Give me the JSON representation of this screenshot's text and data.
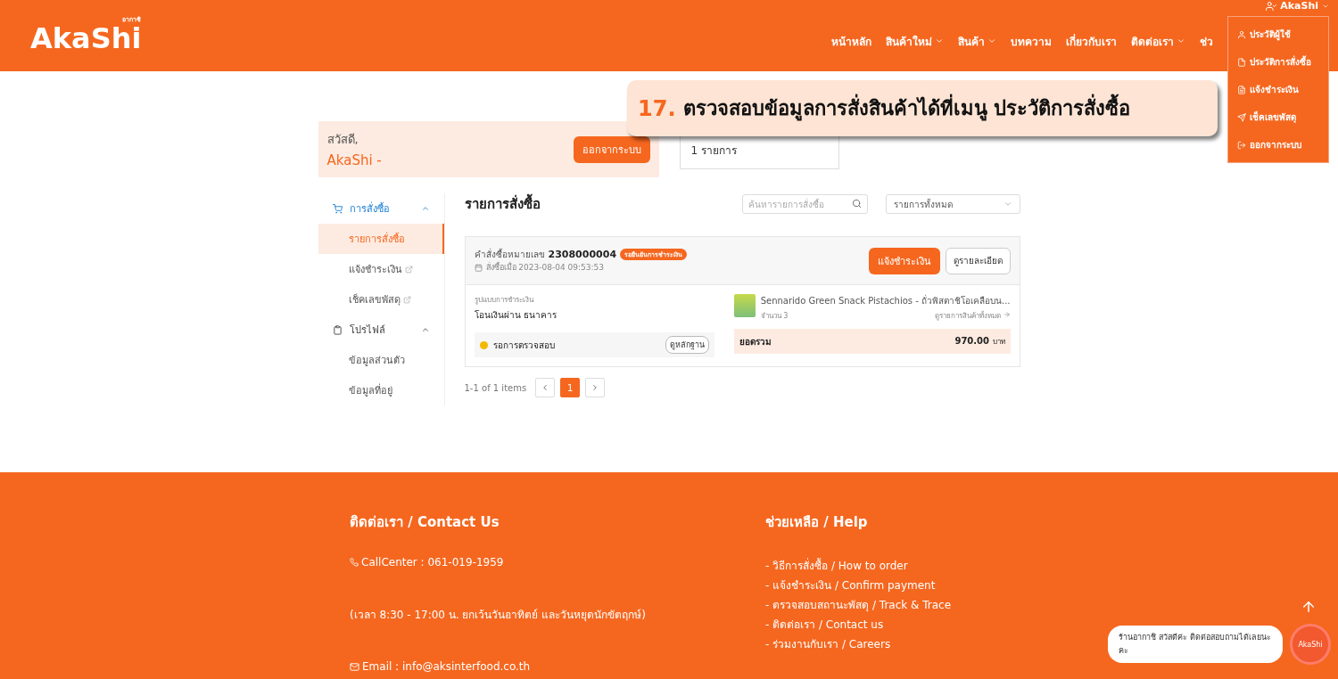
{
  "header": {
    "logo": "AkaShi",
    "logo_sub": "อากาชิ",
    "user": "AkaShi",
    "nav": [
      {
        "label": "หน้าหลัก",
        "dropdown": false
      },
      {
        "label": "สินค้าใหม่",
        "dropdown": true
      },
      {
        "label": "สินค้า",
        "dropdown": true
      },
      {
        "label": "บทความ",
        "dropdown": false
      },
      {
        "label": "เกี่ยวกับเรา",
        "dropdown": false
      },
      {
        "label": "ติดต่อเรา",
        "dropdown": true
      },
      {
        "label": "ช่ว",
        "dropdown": false
      }
    ],
    "user_menu": [
      {
        "label": "ประวัติผู้ใช้",
        "kind": "user"
      },
      {
        "label": "ประวัติการสั่งซื้อ",
        "kind": "file"
      },
      {
        "label": "แจ้งชำระเงิน",
        "kind": "doc"
      },
      {
        "label": "เช็คเลขพัสดุ",
        "kind": "send"
      },
      {
        "label": "ออกจากระบบ",
        "kind": "logout"
      }
    ]
  },
  "banner": {
    "number": "17.",
    "text": "ตรวจสอบข้อมูลการสั่งสินค้าได้ที่เมนู ประวัติการสั่งซื้อ"
  },
  "welcome": {
    "greeting": "สวัสดี,",
    "name": "AkaShi -",
    "button": "ออกจากระบบ"
  },
  "stats": {
    "value": "1 รายการ"
  },
  "sidebar": [
    {
      "label": "การสั่งซื้อ",
      "kind": "cart",
      "expanded": true,
      "children": [
        {
          "label": "รายการสั่งซื้อ",
          "selected": true,
          "external": false
        },
        {
          "label": "แจ้งชำระเงิน",
          "selected": false,
          "external": true
        },
        {
          "label": "เช็คเลขพัสดุ",
          "selected": false,
          "external": true
        }
      ]
    },
    {
      "label": "โปรไฟล์",
      "kind": "profile",
      "expanded": true,
      "children": [
        {
          "label": "ข้อมูลส่วนตัว",
          "selected": false,
          "external": false
        },
        {
          "label": "ข้อมูลที่อยู่",
          "selected": false,
          "external": false
        }
      ]
    }
  ],
  "orders": {
    "title": "รายการสั่งซื้อ",
    "search_placeholder": "ค้นหารายการสั่งซื้อ",
    "filter": "รายการทั้งหมด",
    "order": {
      "number_label": "คำสั่งซื้อหมายเลข",
      "number": "2308000004",
      "status": "รอยืนยันการชำระเงิน",
      "date": "สั่งซื้อเมื่อ 2023-08-04 09:53:53",
      "pay_button": "แจ้งชำระเงิน",
      "detail_button": "ดูรายละเอียด",
      "payment_label": "รูปแบบการชำระเงิน",
      "payment_method": "โอนเงินผ่าน ธนาคาร",
      "check_status": "รอการตรวจสอบ",
      "evidence_button": "ดูหลักฐาน",
      "product": "Sennarido Green Snack Pistachios - ถั่วพิสตาชิโอเคลือบน...",
      "quantity": "จำนวน 3",
      "view_all": "ดูรายการสินค้าทั้งหมด",
      "total_label": "ยอดรวม",
      "total": "970.00",
      "currency": "บาท"
    },
    "pagination": {
      "summary": "1-1 of 1 items",
      "pages": [
        {
          "label": "1",
          "selected": true
        }
      ]
    }
  },
  "footer": {
    "contact_title": "ติดต่อเรา / Contact Us",
    "phone": "CallCenter : 061-019-1959",
    "hours": "(เวลา 8:30 - 17:00 น. ยกเว้นวันอาทิตย์ และวันหยุดนักขัตฤกษ์)",
    "email": "Email : info@aksinterfood.co.th",
    "help_title": "ช่วยเหลือ / Help",
    "help_links": [
      "- วิธีการสั่งซื้อ / How to order",
      "- แจ้งชำระเงิน / Confirm payment",
      "- ตรวจสอบสถานะพัสดุ / Track & Trace",
      "- ติดต่อเรา / Contact us",
      "- ร่วมงานกับเรา / Careers"
    ]
  },
  "chat": {
    "message": "ร้านอากาชิ สวัสดีค่ะ ติดต่อสอบถามได้เลยนะคะ",
    "avatar": "AkaShi"
  }
}
